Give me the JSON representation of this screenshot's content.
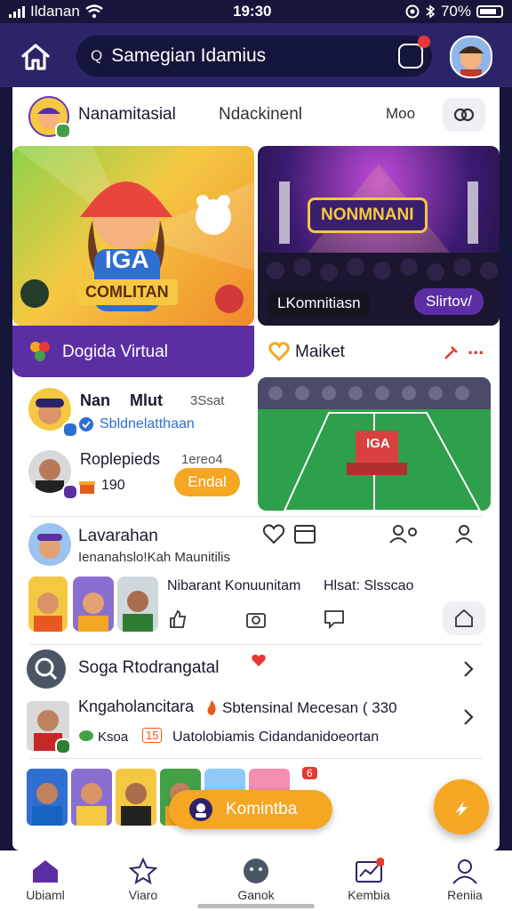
{
  "status": {
    "carrier": "Ildanan",
    "time": "19:30",
    "battery": "70%"
  },
  "header": {
    "search_text": "Samegian Idamius"
  },
  "profile": {
    "name": "Nanamitasial",
    "subtitle": "Ndackinenl",
    "more": "Moo"
  },
  "card_left": {
    "title": "IGA",
    "banner": "COMLITAN"
  },
  "card_right": {
    "sign": "NONMNANI",
    "label": "LKomnitiasn",
    "button": "Slirtov/"
  },
  "purple_bar": {
    "label": "Dogida Virtual"
  },
  "market": {
    "label": "Maiket",
    "more": "..."
  },
  "friends": [
    {
      "name": "Nan",
      "extra": "Mlut",
      "time": "3Ssat",
      "sub": "Sbldnelatthaan"
    },
    {
      "name": "Roplepieds",
      "time": "1ereo4",
      "count": "190",
      "button": "Endal"
    }
  ],
  "field": {
    "sign": "IGA"
  },
  "post": {
    "name": "Lavarahan",
    "sub": "Ienanahslo!Kah Maunitilis",
    "headline": "Nibarant Konuunitam",
    "tail": "Hlsat: Slsscao"
  },
  "list": [
    {
      "label": "Soga Rtodrangatal"
    },
    {
      "label": "Kngaholancitara",
      "desc": "Sbtensinal Mecesan ( 330",
      "tag": "Ksoa",
      "tag2": "Uatolobiamis Cidandanidoeortan",
      "tagnum": "15"
    }
  ],
  "community": {
    "label": "Komintba",
    "badge": "6"
  },
  "nav": [
    {
      "label": "Ubiaml"
    },
    {
      "label": "Viaro"
    },
    {
      "label": "Ganok"
    },
    {
      "label": "Kembia"
    },
    {
      "label": "Reniia"
    }
  ],
  "colors": {
    "header": "#2b2468",
    "accent": "#f5a623",
    "purple": "#5b2fa3"
  }
}
